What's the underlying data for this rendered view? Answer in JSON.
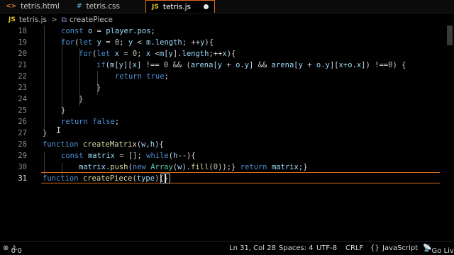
{
  "tabs": [
    {
      "label": "tetris.html",
      "icon": "html-file-icon",
      "icon_glyph": "<>"
    },
    {
      "label": "tetris.css",
      "icon": "css-file-icon",
      "icon_glyph": "#"
    },
    {
      "label": "tetris.js",
      "icon": "js-file-icon",
      "icon_glyph": "JS"
    }
  ],
  "breadcrumb": {
    "file_icon": "JS",
    "file": "tetris.js",
    "separator": ">",
    "symbol": "createPiece"
  },
  "editor": {
    "line_numbers": [
      "18",
      "19",
      "20",
      "21",
      "22",
      "23",
      "24",
      "25",
      "26",
      "27",
      "28",
      "29",
      "30",
      "31"
    ],
    "current_line": "31"
  },
  "status": {
    "errors": "0",
    "warnings": "0",
    "position": "Ln 31, Col 28",
    "spaces": "Spaces: 4",
    "encoding": "UTF-8",
    "eol": "CRLF",
    "braces": "{}",
    "language": "JavaScript",
    "live": "Go Live"
  },
  "colors": {
    "accent": "#e06c1a",
    "keyword": "#4f8fd8",
    "function": "#dcdcaa",
    "class": "#4ec9b0"
  }
}
